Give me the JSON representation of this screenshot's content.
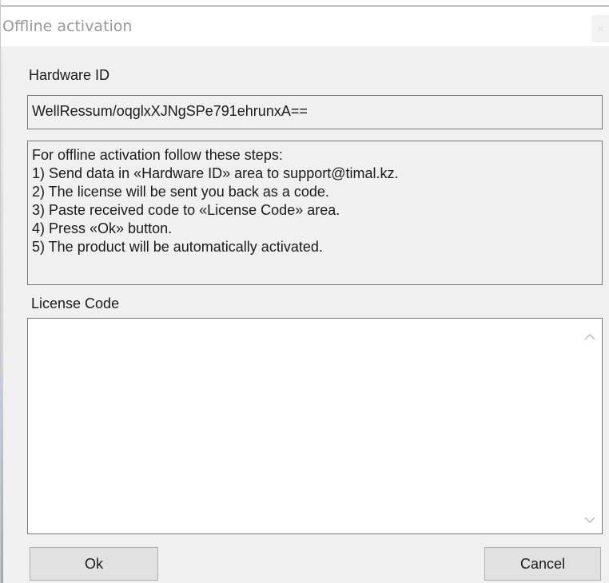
{
  "window": {
    "title": "Offline activation",
    "close_label": "×"
  },
  "hardware": {
    "label": "Hardware ID",
    "value": "WellRessum/oqglxXJNgSPe791ehrunxA=="
  },
  "instructions": {
    "lines": [
      "For offline activation follow these steps:",
      "1) Send data in «Hardware ID» area to support@timal.kz.",
      "2) The license will be sent you back as a code.",
      "3) Paste received code to «License Code» area.",
      "4) Press «Ok» button.",
      "5) The product will be automatically activated."
    ]
  },
  "license": {
    "label": "License Code",
    "value": "",
    "scroll_up_icon": "chevron-up-icon",
    "scroll_down_icon": "chevron-down-icon"
  },
  "buttons": {
    "ok": "Ok",
    "cancel": "Cancel"
  },
  "colors": {
    "dialog_background": "#f0f0f0",
    "title_text": "#999999",
    "border": "#7a7a7a",
    "button_face": "#e1e1e1"
  }
}
